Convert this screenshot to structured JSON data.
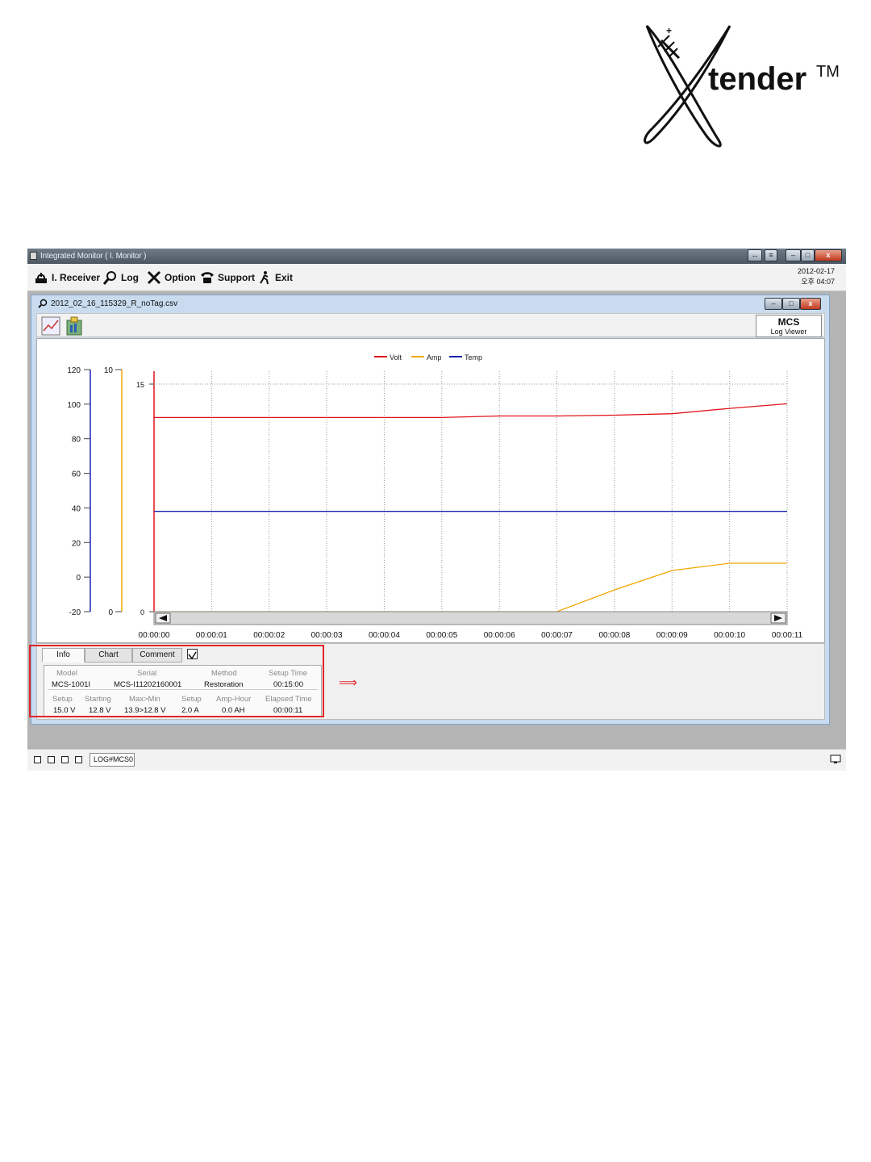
{
  "logo": {
    "brand": "tender",
    "trademark": "TM"
  },
  "window": {
    "title": "Integrated Monitor ( I. Monitor )",
    "datetime_line1": "2012-02-17",
    "datetime_line2": "오후 04:07"
  },
  "menu": [
    {
      "label": "I. Receiver",
      "icon": "receiver-icon"
    },
    {
      "label": "Log",
      "icon": "search-icon"
    },
    {
      "label": "Option",
      "icon": "tools-icon"
    },
    {
      "label": "Support",
      "icon": "phone-icon"
    },
    {
      "label": "Exit",
      "icon": "exit-icon"
    }
  ],
  "log_window": {
    "filename": "2012_02_16_115329_R_noTag.csv",
    "badge_title": "MCS",
    "badge_subtitle": "Log Viewer"
  },
  "chart_data": {
    "type": "line",
    "legend": [
      "Volt",
      "Amp",
      "Temp"
    ],
    "legend_position": "top-center",
    "colors": {
      "Volt": "#e0141b",
      "Amp": "#f0a800",
      "Temp": "#1a22b0"
    },
    "x": [
      "00:00:00",
      "00:00:01",
      "00:00:02",
      "00:00:03",
      "00:00:04",
      "00:00:05",
      "00:00:06",
      "00:00:07",
      "00:00:08",
      "00:00:09",
      "00:00:10",
      "00:00:11"
    ],
    "axes": {
      "temp_axis": {
        "ticks": [
          "120",
          "100",
          "80",
          "60",
          "40",
          "20",
          "0",
          "-20"
        ],
        "range": [
          -20,
          120
        ]
      },
      "amp_axis": {
        "ticks": [
          "10",
          "0"
        ],
        "range": [
          0,
          10
        ]
      },
      "volt_axis": {
        "ticks": [
          "15",
          "0"
        ],
        "range": [
          0,
          15
        ]
      }
    },
    "series": [
      {
        "name": "Volt",
        "axis": "volt",
        "values": [
          12.8,
          12.8,
          12.8,
          12.8,
          12.8,
          12.8,
          12.9,
          12.9,
          12.95,
          13.05,
          13.4,
          13.7
        ]
      },
      {
        "name": "Amp",
        "axis": "amp",
        "values": [
          0,
          0,
          0,
          0,
          0,
          0,
          0,
          0,
          0.9,
          1.7,
          2.0,
          2.0
        ]
      },
      {
        "name": "Temp",
        "axis": "temp",
        "values": [
          38,
          38,
          38,
          38,
          38,
          38,
          38,
          38,
          38,
          38,
          38,
          38
        ]
      }
    ],
    "grid": true
  },
  "tabs": [
    "Info",
    "Chart",
    "Comment"
  ],
  "info": {
    "row1_headers": [
      "Model",
      "Serial",
      "Method",
      "Setup Time"
    ],
    "row1_values": [
      "MCS-1001I",
      "MCS-I11202160001",
      "Restoration",
      "00:15:00"
    ],
    "row2_headers": [
      "Setup",
      "Starting",
      "Max>Min",
      "Setup",
      "Amp-Hour",
      "Elapsed Time"
    ],
    "row2_values": [
      "15.0 V",
      "12.8 V",
      "13.9>12.8 V",
      "2.0 A",
      "0.0 AH",
      "00:00:11"
    ]
  },
  "annotation_arrow": "⟹",
  "statusbar": {
    "tab_label": "LOG#MCS0"
  }
}
